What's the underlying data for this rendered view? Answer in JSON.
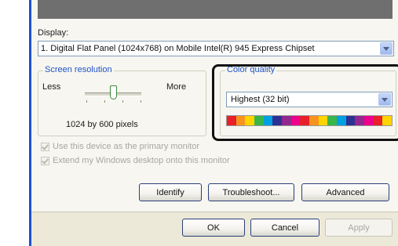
{
  "display": {
    "label": "Display:",
    "selected": "1. Digital Flat Panel (1024x768) on Mobile Intel(R) 945 Express Chipset"
  },
  "screen_resolution": {
    "title": "Screen resolution",
    "less_label": "Less",
    "more_label": "More",
    "slider_level": 0.5,
    "value_text": "1024 by 600 pixels"
  },
  "color_quality": {
    "title": "Color quality",
    "selected": "Highest (32 bit)",
    "swatch_colors": [
      "#e8202a",
      "#f7941d",
      "#ffd400",
      "#39b54a",
      "#00a0e3",
      "#2e3192",
      "#92278f",
      "#ec008c",
      "#e8202a",
      "#f7941d",
      "#ffd400",
      "#39b54a",
      "#00a0e3",
      "#2e3192",
      "#92278f",
      "#ec008c",
      "#e8202a",
      "#ffd400"
    ]
  },
  "options": {
    "primary_monitor": "Use this device as the primary monitor",
    "extend_desktop": "Extend my Windows desktop onto this monitor"
  },
  "buttons": {
    "identify": "Identify",
    "troubleshoot": "Troubleshoot...",
    "advanced": "Advanced",
    "ok": "OK",
    "cancel": "Cancel",
    "apply": "Apply"
  }
}
